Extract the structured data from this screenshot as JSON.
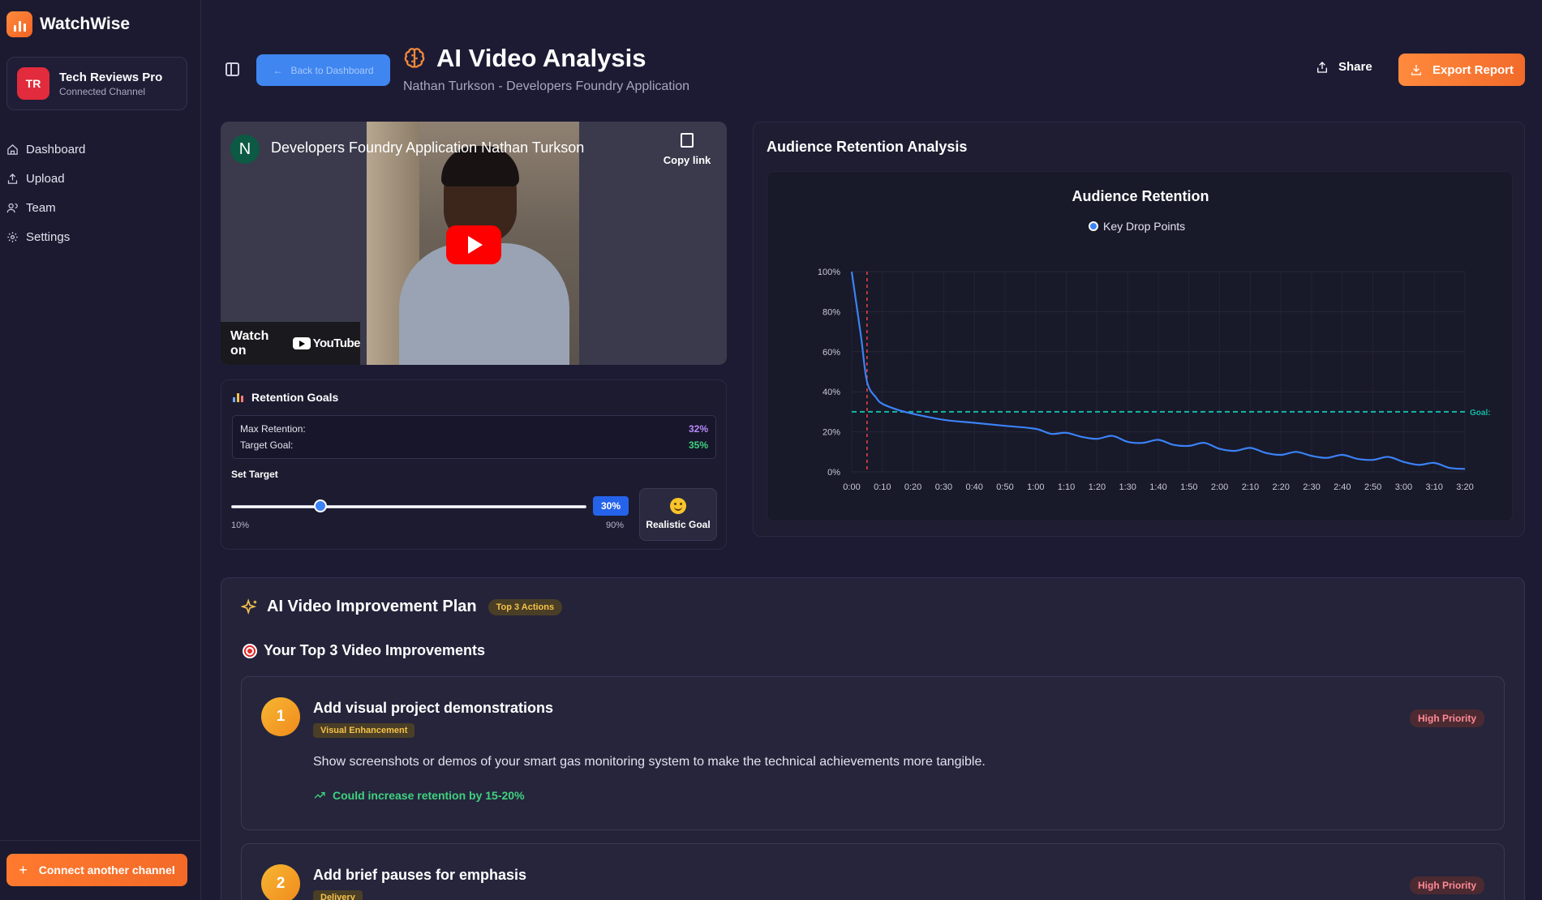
{
  "app": {
    "name": "WatchWise"
  },
  "channel": {
    "initials": "TR",
    "name": "Tech Reviews Pro",
    "status": "Connected Channel"
  },
  "nav": [
    {
      "label": "Dashboard",
      "icon": "home-icon"
    },
    {
      "label": "Upload",
      "icon": "upload-icon"
    },
    {
      "label": "Team",
      "icon": "users-icon"
    },
    {
      "label": "Settings",
      "icon": "gear-icon"
    }
  ],
  "connect_label": "Connect another channel",
  "header": {
    "back_label": "Back to Dashboard",
    "title": "AI Video Analysis",
    "subtitle": "Nathan Turkson - Developers Foundry Application",
    "share_label": "Share",
    "export_label": "Export Report"
  },
  "video": {
    "channel_initial": "N",
    "title": "Developers Foundry Application Nathan Turkson",
    "copy_link": "Copy link",
    "watch_on": "Watch on",
    "platform": "YouTube"
  },
  "goals": {
    "title": "Retention Goals",
    "max_label": "Max Retention:",
    "max_value": "32%",
    "target_label": "Target Goal:",
    "target_value": "35%",
    "set_target": "Set Target",
    "slider_min": "10%",
    "slider_max": "90%",
    "slider_value": "30%",
    "slider_fraction": 0.25,
    "realistic_label": "Realistic Goal"
  },
  "retention": {
    "panel_title": "Audience Retention Analysis",
    "chart_title": "Audience Retention",
    "legend": "Key Drop Points",
    "goal_label": "Goal:"
  },
  "chart_data": {
    "type": "line",
    "title": "Audience Retention",
    "legend": [
      "Key Drop Points"
    ],
    "x_ticks": [
      "0:00",
      "0:10",
      "0:20",
      "0:30",
      "0:40",
      "0:50",
      "1:00",
      "1:10",
      "1:20",
      "1:30",
      "1:40",
      "1:50",
      "2:00",
      "2:10",
      "2:20",
      "2:30",
      "2:40",
      "2:50",
      "3:00",
      "3:10",
      "3:20"
    ],
    "y_ticks": [
      "0%",
      "20%",
      "40%",
      "60%",
      "80%",
      "100%"
    ],
    "ylim": [
      0,
      100
    ],
    "xlim_seconds": [
      0,
      200
    ],
    "series": [
      {
        "x_seconds": [
          0,
          3,
          5,
          8,
          10,
          15,
          20,
          30,
          40,
          50,
          60,
          65,
          70,
          75,
          80,
          85,
          90,
          95,
          100,
          105,
          110,
          115,
          120,
          125,
          130,
          135,
          140,
          145,
          150,
          155,
          160,
          165,
          170,
          175,
          180,
          185,
          190,
          195,
          200
        ],
        "values": [
          100,
          68,
          45,
          37,
          34,
          31,
          29,
          26,
          24.5,
          23,
          21.5,
          19,
          19.5,
          17.5,
          16.5,
          18,
          15,
          14.5,
          16,
          13.5,
          13,
          14.5,
          11.5,
          10.5,
          12,
          9.5,
          8.5,
          10,
          8,
          7,
          8.5,
          6.5,
          6,
          7.5,
          5,
          3.5,
          4.5,
          2,
          1.5
        ]
      }
    ],
    "goal_line": 30,
    "key_drop_x_seconds": 5,
    "colors": {
      "line": "#3b82f6",
      "goal": "#14b8a6",
      "drop": "#ef4444"
    }
  },
  "plan": {
    "title": "AI Video Improvement Plan",
    "badge": "Top 3 Actions",
    "subtitle": "Your Top 3 Video Improvements",
    "items": [
      {
        "num": "1",
        "title": "Add visual project demonstrations",
        "tag": "Visual Enhancement",
        "priority": "High Priority",
        "desc": "Show screenshots or demos of your smart gas monitoring system to make the technical achievements more tangible.",
        "gain": "Could increase retention by 15-20%"
      },
      {
        "num": "2",
        "title": "Add brief pauses for emphasis",
        "tag": "Delivery",
        "priority": "High Priority"
      }
    ]
  },
  "colors": {
    "accent_orange": "#f26a2a",
    "accent_blue": "#3b82f6",
    "success_green": "#3fd27f"
  }
}
